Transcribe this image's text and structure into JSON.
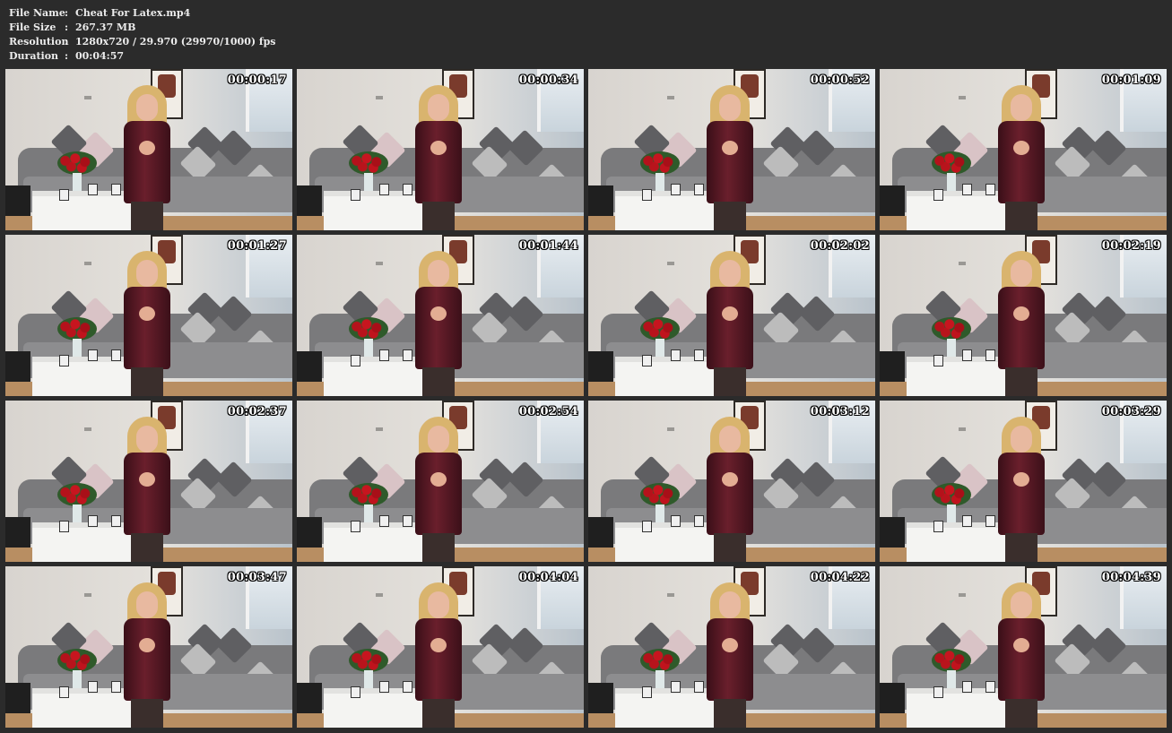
{
  "info": {
    "rows": [
      {
        "key": "File Name",
        "sep": ":",
        "value": "Cheat For Latex.mp4"
      },
      {
        "key": "File Size",
        "sep": ":",
        "value": "267.37 MB"
      },
      {
        "key": "Resolution",
        "sep": ":",
        "value": "1280x720 / 29.970 (29970/1000) fps"
      },
      {
        "key": "Duration",
        "sep": ":",
        "value": "00:04:57"
      }
    ]
  },
  "thumbnails": [
    {
      "time": "00:00:17"
    },
    {
      "time": "00:00:34"
    },
    {
      "time": "00:00:52"
    },
    {
      "time": "00:01:09"
    },
    {
      "time": "00:01:27"
    },
    {
      "time": "00:01:44"
    },
    {
      "time": "00:02:02"
    },
    {
      "time": "00:02:19"
    },
    {
      "time": "00:02:37"
    },
    {
      "time": "00:02:54"
    },
    {
      "time": "00:03:12"
    },
    {
      "time": "00:03:29"
    },
    {
      "time": "00:03:47"
    },
    {
      "time": "00:04:04"
    },
    {
      "time": "00:04:22"
    },
    {
      "time": "00:04:39"
    }
  ],
  "colors": {
    "background": "#2b2b2b",
    "info_text": "#ececec",
    "timestamp_text": "#ffffff"
  }
}
